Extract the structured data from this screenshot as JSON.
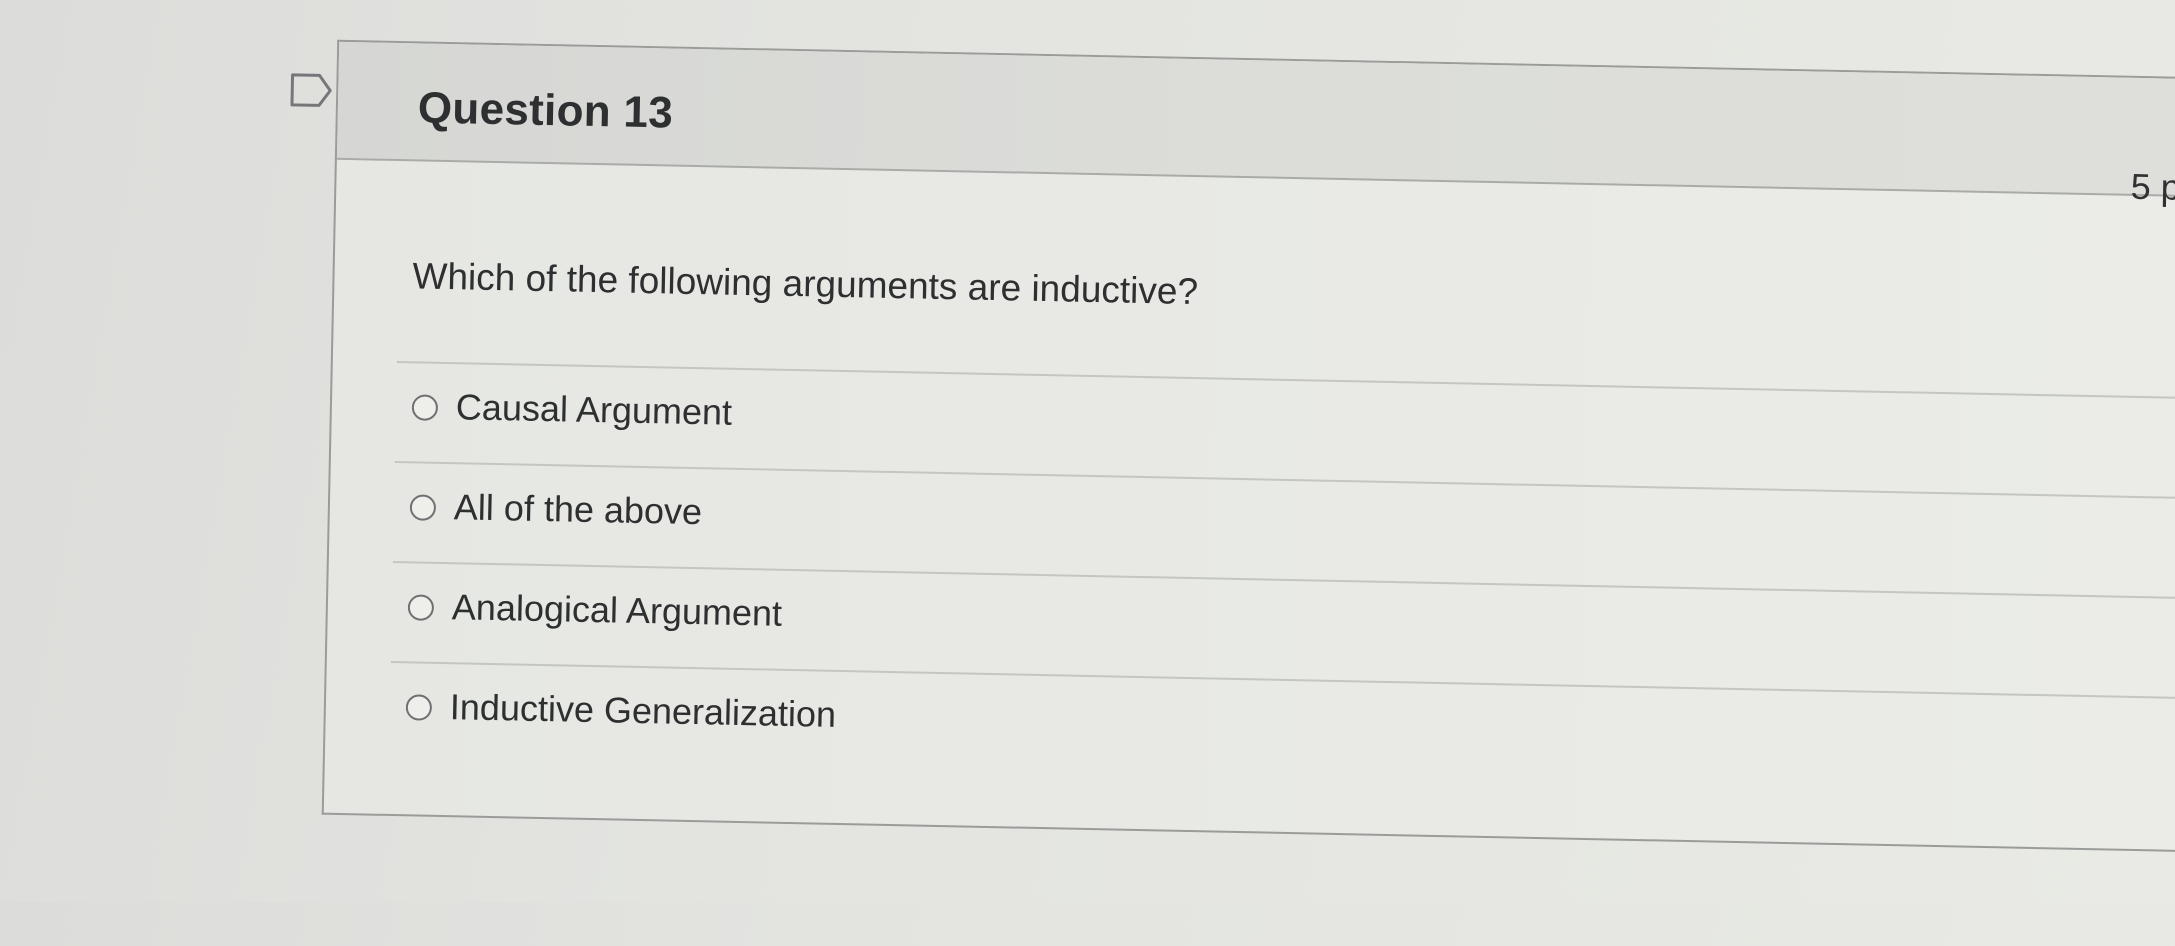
{
  "question": {
    "title": "Question 13",
    "points": "5 p",
    "text": "Which of the following arguments are inductive?",
    "flag_icon": "flag-outline-icon",
    "answers": [
      {
        "label": "Causal Argument",
        "selected": false
      },
      {
        "label": "All of the above",
        "selected": false
      },
      {
        "label": "Analogical Argument",
        "selected": false
      },
      {
        "label": "Inductive Generalization",
        "selected": false
      }
    ]
  },
  "colors": {
    "background": "#e3e4e0",
    "header_background": "#dadbd7",
    "text": "#2d2f30",
    "border": "#9a9c9a"
  }
}
